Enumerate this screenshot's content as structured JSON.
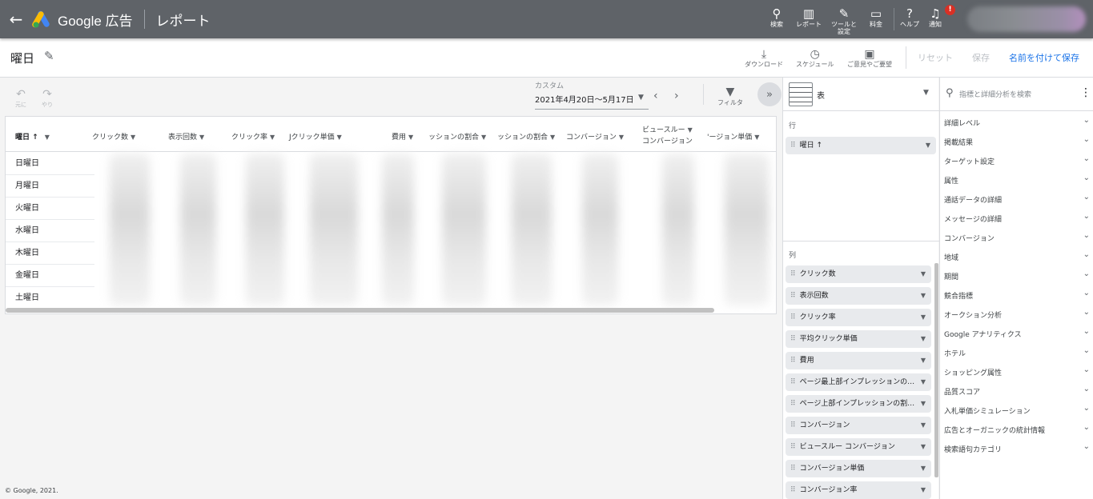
{
  "topbar": {
    "brand": "Google 広告",
    "section": "レポート",
    "tools": [
      {
        "label": "検索",
        "icon": "search-icon",
        "glyph": "🔍︎"
      },
      {
        "label": "レポート",
        "icon": "report-icon",
        "glyph": "▥"
      },
      {
        "label": "ツールと設定",
        "icon": "wrench-icon",
        "glyph": "🔧︎"
      },
      {
        "label": "料金",
        "icon": "credit-card-icon",
        "glyph": "▭"
      }
    ],
    "help_label": "ヘルプ",
    "notify_label": "通知",
    "notify_badge": "!"
  },
  "subhead": {
    "title": "曜日",
    "download_label": "ダウンロード",
    "schedule_label": "スケジュール",
    "feedback_label": "ご意見やご要望",
    "reset_label": "リセット",
    "save_label": "保存",
    "save_as_label": "名前を付けて保存"
  },
  "toolbar": {
    "undo_label": "元に",
    "redo_label": "やり",
    "date_caption": "カスタム",
    "date_range": "2021年4月20日～5月17日",
    "filter_label": "フィルタ"
  },
  "table": {
    "columns": [
      {
        "label": "曜日",
        "sort": "↑"
      },
      {
        "label": "クリック数"
      },
      {
        "label": "表示回数"
      },
      {
        "label": "クリック率"
      },
      {
        "label": "Jクリック単価"
      },
      {
        "label": "費用"
      },
      {
        "label": "ッションの割合"
      },
      {
        "label": "ッションの割合"
      },
      {
        "label": "コンバージョン"
      },
      {
        "label": "ビュースルー"
      },
      {
        "label": "'ージョン単価"
      }
    ],
    "col_sub_label": "コンバージョン",
    "rows": [
      "日曜日",
      "月曜日",
      "火曜日",
      "水曜日",
      "木曜日",
      "金曜日",
      "土曜日"
    ]
  },
  "footer": {
    "copyright": "© Google, 2021."
  },
  "editor": {
    "viz_name": "表",
    "rows_label": "行",
    "row_chip": "曜日 ↑",
    "cols_label": "列",
    "col_chips": [
      "クリック数",
      "表示回数",
      "クリック率",
      "平均クリック単価",
      "費用",
      "ページ最上部インプレッションの…",
      "ページ上部インプレッションの割…",
      "コンバージョン",
      "ビュースルー コンバージョン",
      "コンバージョン単価",
      "コンバージョン率"
    ]
  },
  "metrics": {
    "search_placeholder": "指標と詳細分析を検索",
    "categories": [
      "詳細レベル",
      "掲載結果",
      "ターゲット設定",
      "属性",
      "通話データの詳細",
      "メッセージの詳細",
      "コンバージョン",
      "地域",
      "期間",
      "競合指標",
      "オークション分析",
      "Google アナリティクス",
      "ホテル",
      "ショッピング属性",
      "品質スコア",
      "入札単価シミュレーション",
      "広告とオーガニックの統計情報",
      "検索語句カテゴリ"
    ]
  }
}
